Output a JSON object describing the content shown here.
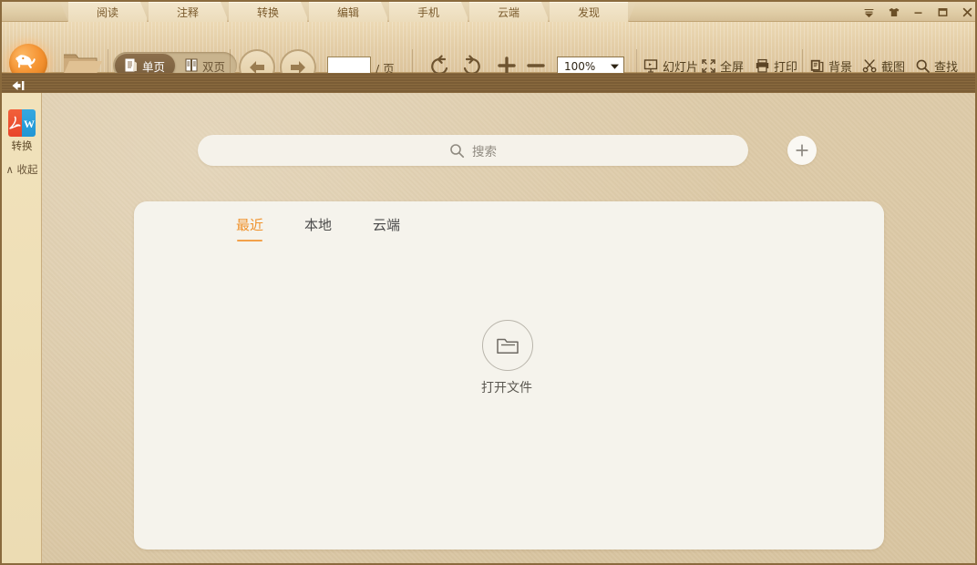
{
  "window": {
    "controls": [
      {
        "name": "skin-dropdown-icon",
        "glyph": "▼"
      },
      {
        "name": "theme-shirt-icon",
        "glyph": "👕"
      },
      {
        "name": "minimize-icon",
        "glyph": "—"
      },
      {
        "name": "maximize-icon",
        "glyph": "□"
      },
      {
        "name": "close-icon",
        "glyph": "✕"
      }
    ]
  },
  "tabstrip": {
    "tabs": [
      {
        "label": "阅读"
      },
      {
        "label": "注释"
      },
      {
        "label": "转换"
      },
      {
        "label": "编辑"
      },
      {
        "label": "手机"
      },
      {
        "label": "云端"
      },
      {
        "label": "发现"
      }
    ]
  },
  "toolbar": {
    "logo_name": "elephant-logo",
    "open_folder_name": "open-folder-button",
    "page_mode": {
      "single_label": "单页",
      "double_label": "双页",
      "selected": "单页"
    },
    "nav": {
      "prev_name": "previous-page-button",
      "next_name": "next-page-button"
    },
    "page_input": {
      "value": "",
      "placeholder": "",
      "suffix": "/ 页"
    },
    "rotate_left_name": "rotate-left-button",
    "rotate_right_name": "rotate-right-button",
    "zoom_in_label": "+",
    "zoom_out_label": "—",
    "zoom_level": "100%",
    "actions": [
      {
        "label": "幻灯片",
        "icon": "slideshow-icon"
      },
      {
        "label": "全屏",
        "icon": "fullscreen-icon"
      },
      {
        "label": "打印",
        "icon": "print-icon"
      },
      {
        "label": "背景",
        "icon": "background-icon"
      },
      {
        "label": "截图",
        "icon": "scissors-icon"
      },
      {
        "label": "查找",
        "icon": "search-icon"
      }
    ]
  },
  "sidebar": {
    "collapse_panel_name": "collapse-panel-arrow",
    "convert_label": "转换",
    "collapse_label": "∧ 收起"
  },
  "main": {
    "search": {
      "placeholder": "搜索",
      "value": ""
    },
    "add_button_label": "+",
    "tabs": [
      {
        "label": "最近",
        "active": true
      },
      {
        "label": "本地",
        "active": false
      },
      {
        "label": "云端",
        "active": false
      }
    ],
    "open_file_label": "打开文件"
  },
  "colors": {
    "accent": "#f0932e",
    "toolbar_bg": "#e3cda6",
    "panel_bg": "#f5f3ec",
    "border": "#8a6a3d"
  }
}
